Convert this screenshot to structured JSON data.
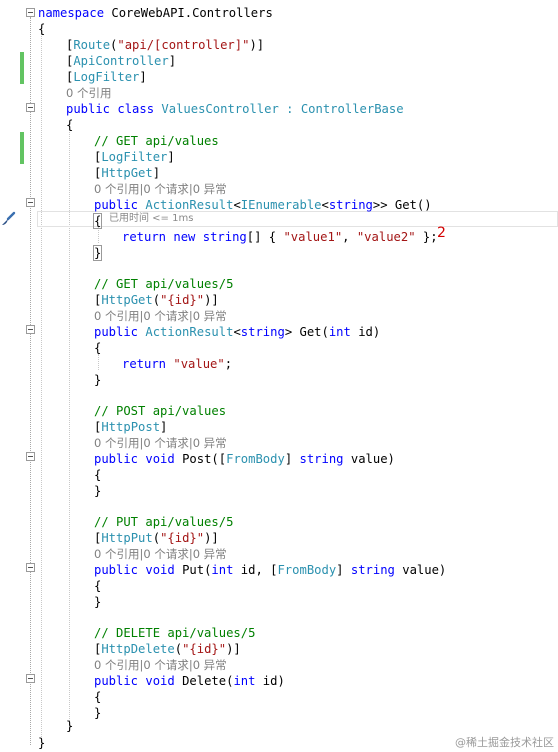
{
  "editor": {
    "lines": {
      "l1": [
        "namespace",
        " CoreWebAPI.Controllers"
      ],
      "l2": "{",
      "l3": [
        "[",
        "Route",
        "(",
        "\"api/[controller]\"",
        ")]"
      ],
      "l4": [
        "[",
        "ApiController",
        "]"
      ],
      "l5": [
        "[",
        "LogFilter",
        "]"
      ],
      "l6": "0 个引用",
      "l7": [
        "public",
        " ",
        "class",
        " ",
        "ValuesController",
        " : ",
        "ControllerBase"
      ],
      "l8": "{",
      "l9": "// GET api/values",
      "l10": [
        "[",
        "LogFilter",
        "]"
      ],
      "l11": [
        "[",
        "HttpGet",
        "]"
      ],
      "l12": "0 个引用|0 个请求|0 异常",
      "l13": [
        "public",
        " ",
        "ActionResult",
        "<",
        "IEnumerable",
        "<",
        "string",
        ">> Get()"
      ],
      "l14": "{",
      "l14_tip": "已用时间 <= 1ms",
      "l15": [
        "return",
        " ",
        "new",
        " ",
        "string",
        "[] { ",
        "\"value1\"",
        ", ",
        "\"value2\"",
        " };"
      ],
      "l16": "}",
      "l17": "// GET api/values/5",
      "l18": [
        "[",
        "HttpGet",
        "(",
        "\"{id}\"",
        ")]"
      ],
      "l19": "0 个引用|0 个请求|0 异常",
      "l20": [
        "public",
        " ",
        "ActionResult",
        "<",
        "string",
        "> Get(",
        "int",
        " id)"
      ],
      "l21": "{",
      "l22": [
        "return",
        " ",
        "\"value\"",
        ";"
      ],
      "l23": "}",
      "l24": "// POST api/values",
      "l25": [
        "[",
        "HttpPost",
        "]"
      ],
      "l26": "0 个引用|0 个请求|0 异常",
      "l27": [
        "public",
        " ",
        "void",
        " Post([",
        "FromBody",
        "] ",
        "string",
        " value)"
      ],
      "l28": "{",
      "l29": "}",
      "l30": "// PUT api/values/5",
      "l31": [
        "[",
        "HttpPut",
        "(",
        "\"{id}\"",
        ")]"
      ],
      "l32": "0 个引用|0 个请求|0 异常",
      "l33": [
        "public",
        " ",
        "void",
        " Put(",
        "int",
        " id, [",
        "FromBody",
        "] ",
        "string",
        " value)"
      ],
      "l34": "{",
      "l35": "}",
      "l36": "// DELETE api/values/5",
      "l37": [
        "[",
        "HttpDelete",
        "(",
        "\"{id}\"",
        ")]"
      ],
      "l38": "0 个引用|0 个请求|0 异常",
      "l39": [
        "public",
        " ",
        "void",
        " Delete(",
        "int",
        " id)"
      ],
      "l40": "{",
      "l41": "}",
      "l42": "}",
      "l43": "}"
    },
    "return_value_annotation": "2",
    "colors": {
      "keyword": "#0000ff",
      "type": "#2b91af",
      "string": "#a31515",
      "comment": "#008000",
      "codelens": "#808080",
      "changed_bar": "#62c462",
      "annotation": "#d40000"
    }
  },
  "icons": {
    "breakpoint_brush": "paintbrush-icon",
    "fold": "collapse-icon"
  },
  "watermark": "@稀土掘金技术社区"
}
